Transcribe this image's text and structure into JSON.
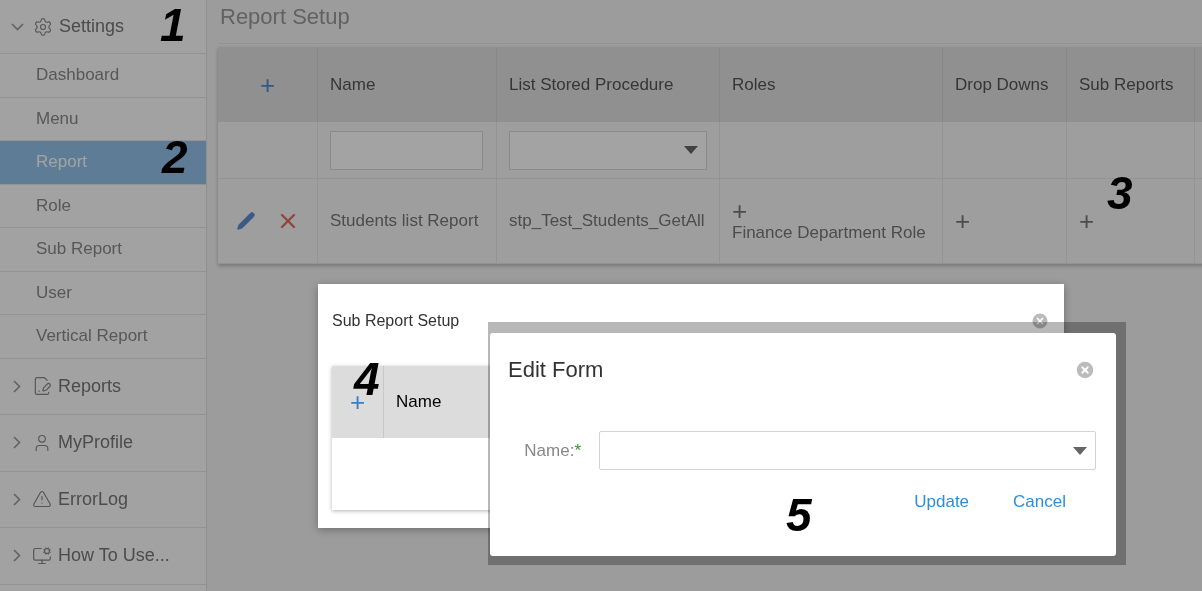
{
  "sidebar": {
    "items": [
      {
        "label": "Settings",
        "expanded": true,
        "children": [
          {
            "label": "Dashboard",
            "selected": false
          },
          {
            "label": "Menu",
            "selected": false
          },
          {
            "label": "Report",
            "selected": true
          },
          {
            "label": "Role",
            "selected": false
          },
          {
            "label": "Sub Report",
            "selected": false
          },
          {
            "label": "User",
            "selected": false
          },
          {
            "label": "Vertical Report",
            "selected": false
          }
        ]
      },
      {
        "label": "Reports",
        "expanded": false
      },
      {
        "label": "MyProfile",
        "expanded": false
      },
      {
        "label": "ErrorLog",
        "expanded": false
      },
      {
        "label": "How To Use...",
        "expanded": false
      }
    ]
  },
  "page": {
    "title": "Report Setup",
    "table": {
      "add_button": "+",
      "columns": [
        "Name",
        "List Stored Procedure",
        "Roles",
        "Drop Downs",
        "Sub Reports"
      ],
      "rows": [
        {
          "name": "Students list Report",
          "procedure": "stp_Test_Students_GetAll",
          "roles_add": "+",
          "roles": "Finance Department Role",
          "drop_downs_add": "+",
          "sub_reports_add": "+"
        }
      ]
    }
  },
  "sub_report_dialog": {
    "title": "Sub Report Setup",
    "add_button": "+",
    "columns": [
      "Name"
    ]
  },
  "edit_dialog": {
    "title": "Edit Form",
    "field": {
      "label": "Name:",
      "required": "*"
    },
    "buttons": [
      "Update",
      "Cancel"
    ]
  },
  "annotations": [
    "1",
    "2",
    "3",
    "4",
    "5"
  ]
}
